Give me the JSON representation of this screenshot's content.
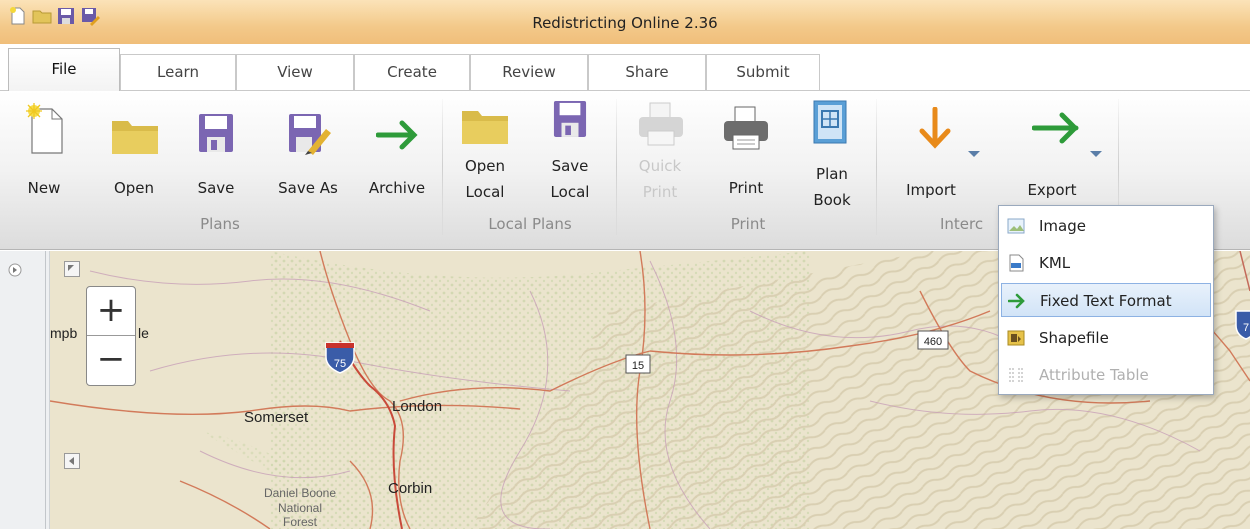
{
  "title_bar": {
    "title": "Redistricting Online 2.36",
    "quick_access": [
      "new-file-icon",
      "open-folder-icon",
      "save-icon",
      "save-as-icon"
    ]
  },
  "tabs": [
    {
      "label": "File",
      "active": true
    },
    {
      "label": "Learn"
    },
    {
      "label": "View"
    },
    {
      "label": "Create"
    },
    {
      "label": "Review"
    },
    {
      "label": "Share"
    },
    {
      "label": "Submit"
    }
  ],
  "ribbon": {
    "buttons": {
      "new": {
        "label": "New",
        "icon": "new-file-icon"
      },
      "open": {
        "label": "Open",
        "icon": "open-folder-icon"
      },
      "save": {
        "label": "Save",
        "icon": "save-icon"
      },
      "save_as": {
        "label": "Save As",
        "icon": "save-as-icon"
      },
      "archive": {
        "label": "Archive",
        "icon": "arrow-right-icon"
      },
      "open_local": {
        "line1": "Open",
        "line2": "Local",
        "icon": "open-folder-icon"
      },
      "save_local": {
        "line1": "Save",
        "line2": "Local",
        "icon": "save-icon"
      },
      "quick_print": {
        "line1": "Quick",
        "line2": "Print",
        "icon": "printer-icon",
        "disabled": true
      },
      "print": {
        "label": "Print",
        "icon": "printer-icon"
      },
      "plan_book": {
        "line1": "Plan",
        "line2": "Book",
        "icon": "book-icon"
      },
      "import": {
        "label": "Import",
        "icon": "arrow-down-icon"
      },
      "export": {
        "label": "Export",
        "icon": "arrow-right-icon"
      }
    },
    "groups": {
      "plans": "Plans",
      "local_plans": "Local Plans",
      "print": "Print",
      "interop": "Interc"
    }
  },
  "export_menu": {
    "items": [
      {
        "label": "Image",
        "icon": "image-icon"
      },
      {
        "label": "KML",
        "icon": "kml-icon"
      },
      {
        "label": "Fixed Text Format",
        "icon": "arrow-right-icon",
        "highlighted": true
      },
      {
        "label": "Shapefile",
        "icon": "shapefile-icon"
      },
      {
        "label": "Attribute Table",
        "icon": "table-icon",
        "disabled": true
      }
    ]
  },
  "map": {
    "zoom_in": "+",
    "zoom_out": "−",
    "places": {
      "campbellsville_partial": "mpb",
      "campbellsville_end": "le",
      "somerset": "Somerset",
      "london": "London",
      "corbin": "Corbin",
      "daniel_boone_1": "Daniel Boone",
      "daniel_boone_2": "National",
      "daniel_boone_3": "Forest"
    },
    "shields": {
      "i75": "75",
      "us15": "15",
      "us460": "460",
      "i75_right": "7"
    }
  },
  "colors": {
    "title_bar": "#f3c98a",
    "highlight": "#d2e4f7",
    "green_arrow": "#2e9b3a",
    "orange_arrow": "#e88a1a",
    "save_purple": "#7b66b2"
  }
}
